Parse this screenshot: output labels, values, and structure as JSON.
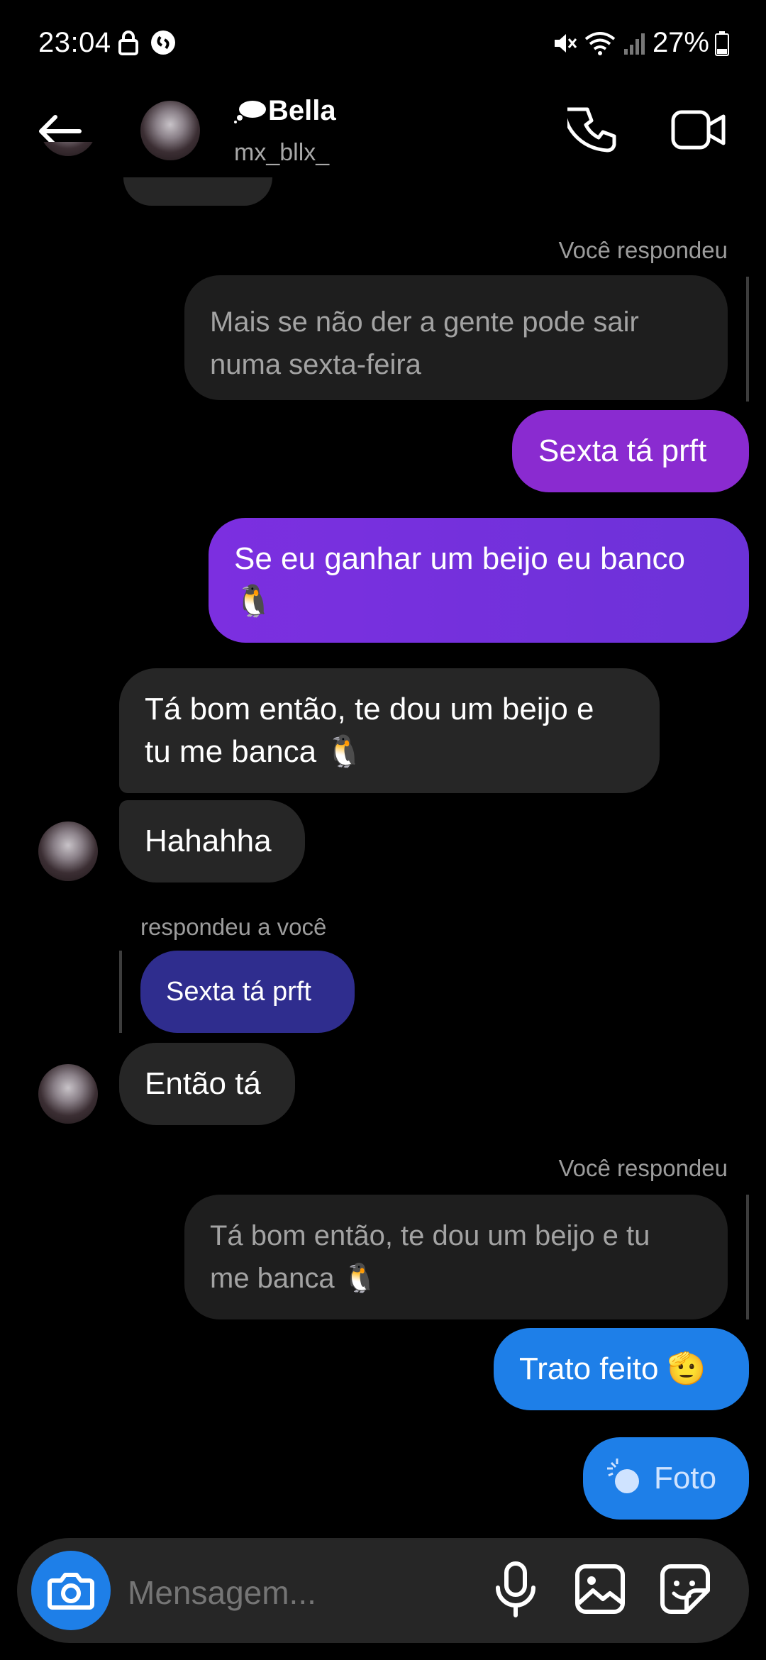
{
  "status_bar": {
    "time": "23:04",
    "battery": "27%"
  },
  "header": {
    "name": "Bella",
    "username": "mx_bllx_"
  },
  "messages": {
    "you_replied_1": "Você respondeu",
    "quote_1": "Mais se não der a gente pode sair numa sexta-feira",
    "out_1": "Sexta tá prft",
    "out_2_line1": "Se eu ganhar um beijo eu banco",
    "out_2_emoji": "🐧",
    "in_1_line1": "Tá bom então, te dou um beijo e",
    "in_1_line2": "tu me banca 🐧",
    "in_2": "Hahahha",
    "replied_to_you": "respondeu a você",
    "quoted_mine": "Sexta tá prft",
    "in_3": "Então tá",
    "you_replied_2": "Você respondeu",
    "quote_2_line1": "Tá bom então, te dou um beijo e tu",
    "quote_2_line2": "me banca 🐧",
    "out_3": "Trato feito 🫡",
    "out_4": "Foto"
  },
  "composer": {
    "placeholder": "Mensagem..."
  },
  "colors": {
    "accent_blue": "#1e7fe8",
    "purple": "#8a2bd0",
    "indigo": "#2f2d8e"
  },
  "icons": [
    "back-arrow-icon",
    "lock-icon",
    "shazam-icon",
    "mute-icon",
    "wifi-icon",
    "signal-icon",
    "battery-icon",
    "phone-icon",
    "video-icon",
    "camera-icon",
    "microphone-icon",
    "gallery-icon",
    "sticker-icon"
  ]
}
